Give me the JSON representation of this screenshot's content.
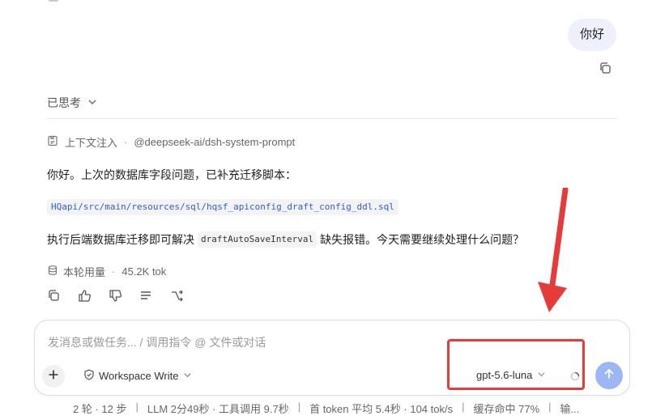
{
  "chat": {
    "user_message": "你好",
    "thought_label": "已思考",
    "context_label": "上下文注入",
    "context_source": "@deepseek-ai/dsh-system-prompt",
    "reply_line1": "你好。上次的数据库字段问题，已补充迁移脚本：",
    "reply_file_path": "HQapi/src/main/resources/sql/hqsf_apiconfig_draft_config_ddl.sql",
    "reply_line3_before": "执行后端数据库迁移即可解决",
    "reply_inline_code": "draftAutoSaveInterval",
    "reply_line3_after": "缺失报错。今天需要继续处理什么问题？",
    "usage_label": "本轮用量",
    "usage_value": "45.2K tok"
  },
  "composer": {
    "placeholder": "发消息或做任务... / 调用指令 @ 文件或对话",
    "workspace_label": "Workspace Write",
    "model_label": "gpt-5.6-luna"
  },
  "status_bar": {
    "steps": "2 轮 · 12 步",
    "llm": "LLM 2分49秒 · 工具调用 9.7秒",
    "first_token": "首 token 平均 5.4秒 · 104 tok/s",
    "cache": "缓存命中 77%",
    "truncated": "输..."
  },
  "colors": {
    "accent": "#2f5fd0",
    "annotation_red": "#e53b3b",
    "send_button": "#9db7f5",
    "user_bubble": "#eef1fb"
  },
  "icons": [
    "copy-icon",
    "chevron-down-icon",
    "context-icon",
    "database-icon",
    "thumb-up-icon",
    "thumb-down-icon",
    "list-icon",
    "branch-icon",
    "plus-icon",
    "shield-icon",
    "spinner-icon",
    "arrow-up-icon"
  ]
}
